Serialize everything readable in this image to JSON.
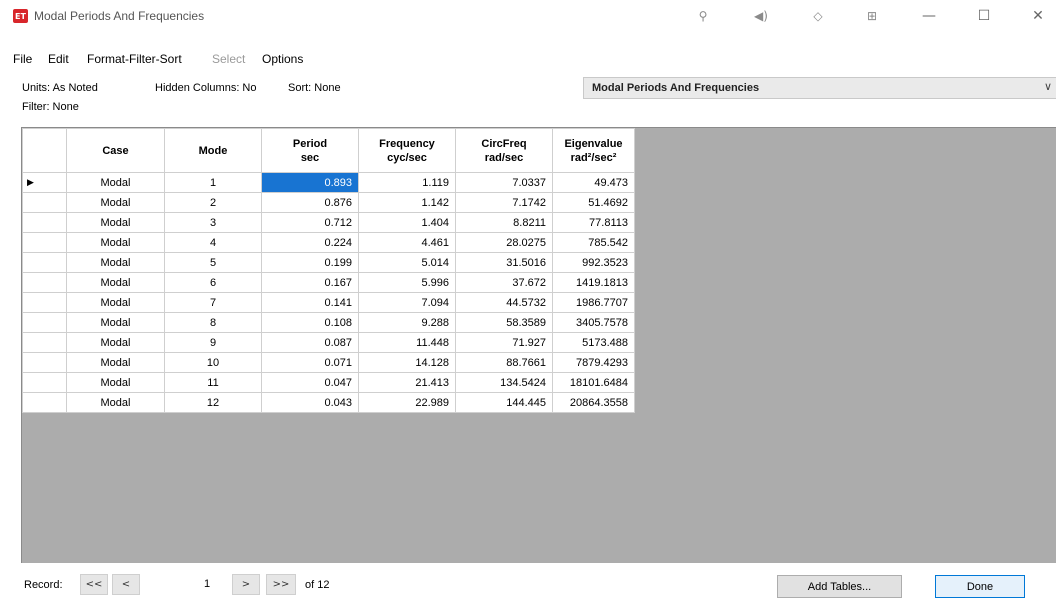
{
  "window": {
    "title": "Modal Periods And Frequencies",
    "app_icon_text": "ET",
    "toolbar_icons": [
      "pin-icon",
      "sound-icon",
      "target-icon",
      "export-icon"
    ],
    "controls": {
      "minimize": "—",
      "maximize": "☐",
      "close": "✕"
    }
  },
  "menu": {
    "file": "File",
    "edit": "Edit",
    "format": "Format-Filter-Sort",
    "select": "Select",
    "options": "Options"
  },
  "info": {
    "units": "Units: As Noted",
    "hidden_columns": "Hidden Columns: No",
    "sort": "Sort: None",
    "filter": "Filter: None"
  },
  "table_selector": {
    "selected": "Modal Periods And Frequencies",
    "arrow": "∨"
  },
  "table": {
    "columns": [
      {
        "name": "Case",
        "unit": ""
      },
      {
        "name": "Mode",
        "unit": ""
      },
      {
        "name": "Period",
        "unit": "sec"
      },
      {
        "name": "Frequency",
        "unit": "cyc/sec"
      },
      {
        "name": "CircFreq",
        "unit": "rad/sec"
      },
      {
        "name": "Eigenvalue",
        "unit": "rad²/sec²"
      }
    ],
    "current_row_marker": "▶",
    "rows": [
      [
        "Modal",
        "1",
        "0.893",
        "1.119",
        "7.0337",
        "49.473"
      ],
      [
        "Modal",
        "2",
        "0.876",
        "1.142",
        "7.1742",
        "51.4692"
      ],
      [
        "Modal",
        "3",
        "0.712",
        "1.404",
        "8.8211",
        "77.8113"
      ],
      [
        "Modal",
        "4",
        "0.224",
        "4.461",
        "28.0275",
        "785.542"
      ],
      [
        "Modal",
        "5",
        "0.199",
        "5.014",
        "31.5016",
        "992.3523"
      ],
      [
        "Modal",
        "6",
        "0.167",
        "5.996",
        "37.672",
        "1419.1813"
      ],
      [
        "Modal",
        "7",
        "0.141",
        "7.094",
        "44.5732",
        "1986.7707"
      ],
      [
        "Modal",
        "8",
        "0.108",
        "9.288",
        "58.3589",
        "3405.7578"
      ],
      [
        "Modal",
        "9",
        "0.087",
        "11.448",
        "71.927",
        "5173.488"
      ],
      [
        "Modal",
        "10",
        "0.071",
        "14.128",
        "88.7661",
        "7879.4293"
      ],
      [
        "Modal",
        "11",
        "0.047",
        "21.413",
        "134.5424",
        "18101.6484"
      ],
      [
        "Modal",
        "12",
        "0.043",
        "22.989",
        "144.445",
        "20864.3558"
      ]
    ]
  },
  "navigation": {
    "label": "Record:",
    "first": "<<",
    "prev": "<",
    "current": "1",
    "next": ">",
    "last": ">>",
    "total": "of 12"
  },
  "buttons": {
    "add_tables": "Add Tables...",
    "done": "Done"
  }
}
